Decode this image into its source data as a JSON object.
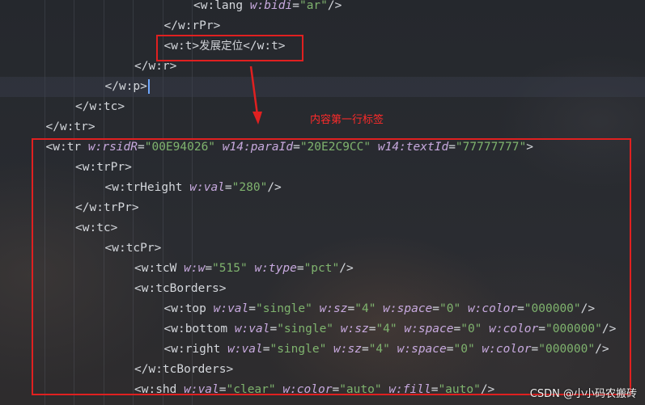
{
  "colors": {
    "background": "#23262b",
    "tag": "#d4d7dc",
    "attribute_name": "#c7a9de",
    "attribute_value": "#7fb36e",
    "annotation_red": "#e02020",
    "caret": "#6fa8ff"
  },
  "code_lines": [
    {
      "indent": 6,
      "tokens": [
        {
          "k": "tag",
          "t": "<w:lang "
        },
        {
          "k": "an",
          "t": "w:bidi"
        },
        {
          "k": "tag",
          "t": "="
        },
        {
          "k": "av",
          "t": "\"ar\""
        },
        {
          "k": "tag",
          "t": "/>"
        }
      ]
    },
    {
      "indent": 5,
      "tokens": [
        {
          "k": "tag",
          "t": "</w:rPr>"
        }
      ]
    },
    {
      "indent": 5,
      "tokens": [
        {
          "k": "tag",
          "t": "<w:t>"
        },
        {
          "k": "tx",
          "t": "发展定位"
        },
        {
          "k": "tag",
          "t": "</w:t>"
        }
      ]
    },
    {
      "indent": 4,
      "tokens": [
        {
          "k": "tag",
          "t": "</w:r>"
        }
      ]
    },
    {
      "indent": 3,
      "current": true,
      "tokens": [
        {
          "k": "tag",
          "t": "</w:p>"
        }
      ]
    },
    {
      "indent": 2,
      "tokens": [
        {
          "k": "tag",
          "t": "</w:tc>"
        }
      ]
    },
    {
      "indent": 1,
      "tokens": [
        {
          "k": "tag",
          "t": "</w:tr>"
        }
      ]
    },
    {
      "indent": 1,
      "tokens": [
        {
          "k": "tag",
          "t": "<w:tr "
        },
        {
          "k": "an",
          "t": "w:rsidR"
        },
        {
          "k": "tag",
          "t": "="
        },
        {
          "k": "av",
          "t": "\"00E94026\""
        },
        {
          "k": "tag",
          "t": " "
        },
        {
          "k": "an",
          "t": "w14:paraId"
        },
        {
          "k": "tag",
          "t": "="
        },
        {
          "k": "av",
          "t": "\"20E2C9CC\""
        },
        {
          "k": "tag",
          "t": " "
        },
        {
          "k": "an",
          "t": "w14:textId"
        },
        {
          "k": "tag",
          "t": "="
        },
        {
          "k": "av",
          "t": "\"77777777\""
        },
        {
          "k": "tag",
          "t": ">"
        }
      ]
    },
    {
      "indent": 2,
      "tokens": [
        {
          "k": "tag",
          "t": "<w:trPr>"
        }
      ]
    },
    {
      "indent": 3,
      "tokens": [
        {
          "k": "tag",
          "t": "<w:trHeight "
        },
        {
          "k": "an",
          "t": "w:val"
        },
        {
          "k": "tag",
          "t": "="
        },
        {
          "k": "av",
          "t": "\"280\""
        },
        {
          "k": "tag",
          "t": "/>"
        }
      ]
    },
    {
      "indent": 2,
      "tokens": [
        {
          "k": "tag",
          "t": "</w:trPr>"
        }
      ]
    },
    {
      "indent": 2,
      "tokens": [
        {
          "k": "tag",
          "t": "<w:tc>"
        }
      ]
    },
    {
      "indent": 3,
      "tokens": [
        {
          "k": "tag",
          "t": "<w:tcPr>"
        }
      ]
    },
    {
      "indent": 4,
      "tokens": [
        {
          "k": "tag",
          "t": "<w:tcW "
        },
        {
          "k": "an",
          "t": "w:w"
        },
        {
          "k": "tag",
          "t": "="
        },
        {
          "k": "av",
          "t": "\"515\""
        },
        {
          "k": "tag",
          "t": " "
        },
        {
          "k": "an",
          "t": "w:type"
        },
        {
          "k": "tag",
          "t": "="
        },
        {
          "k": "av",
          "t": "\"pct\""
        },
        {
          "k": "tag",
          "t": "/>"
        }
      ]
    },
    {
      "indent": 4,
      "tokens": [
        {
          "k": "tag",
          "t": "<w:tcBorders>"
        }
      ]
    },
    {
      "indent": 5,
      "tokens": [
        {
          "k": "tag",
          "t": "<w:top "
        },
        {
          "k": "an",
          "t": "w:val"
        },
        {
          "k": "tag",
          "t": "="
        },
        {
          "k": "av",
          "t": "\"single\""
        },
        {
          "k": "tag",
          "t": " "
        },
        {
          "k": "an",
          "t": "w:sz"
        },
        {
          "k": "tag",
          "t": "="
        },
        {
          "k": "av",
          "t": "\"4\""
        },
        {
          "k": "tag",
          "t": " "
        },
        {
          "k": "an",
          "t": "w:space"
        },
        {
          "k": "tag",
          "t": "="
        },
        {
          "k": "av",
          "t": "\"0\""
        },
        {
          "k": "tag",
          "t": " "
        },
        {
          "k": "an",
          "t": "w:color"
        },
        {
          "k": "tag",
          "t": "="
        },
        {
          "k": "av",
          "t": "\"000000\""
        },
        {
          "k": "tag",
          "t": "/>"
        }
      ]
    },
    {
      "indent": 5,
      "tokens": [
        {
          "k": "tag",
          "t": "<w:bottom "
        },
        {
          "k": "an",
          "t": "w:val"
        },
        {
          "k": "tag",
          "t": "="
        },
        {
          "k": "av",
          "t": "\"single\""
        },
        {
          "k": "tag",
          "t": " "
        },
        {
          "k": "an",
          "t": "w:sz"
        },
        {
          "k": "tag",
          "t": "="
        },
        {
          "k": "av",
          "t": "\"4\""
        },
        {
          "k": "tag",
          "t": " "
        },
        {
          "k": "an",
          "t": "w:space"
        },
        {
          "k": "tag",
          "t": "="
        },
        {
          "k": "av",
          "t": "\"0\""
        },
        {
          "k": "tag",
          "t": " "
        },
        {
          "k": "an",
          "t": "w:color"
        },
        {
          "k": "tag",
          "t": "="
        },
        {
          "k": "av",
          "t": "\"000000\""
        },
        {
          "k": "tag",
          "t": "/>"
        }
      ]
    },
    {
      "indent": 5,
      "tokens": [
        {
          "k": "tag",
          "t": "<w:right "
        },
        {
          "k": "an",
          "t": "w:val"
        },
        {
          "k": "tag",
          "t": "="
        },
        {
          "k": "av",
          "t": "\"single\""
        },
        {
          "k": "tag",
          "t": " "
        },
        {
          "k": "an",
          "t": "w:sz"
        },
        {
          "k": "tag",
          "t": "="
        },
        {
          "k": "av",
          "t": "\"4\""
        },
        {
          "k": "tag",
          "t": " "
        },
        {
          "k": "an",
          "t": "w:space"
        },
        {
          "k": "tag",
          "t": "="
        },
        {
          "k": "av",
          "t": "\"0\""
        },
        {
          "k": "tag",
          "t": " "
        },
        {
          "k": "an",
          "t": "w:color"
        },
        {
          "k": "tag",
          "t": "="
        },
        {
          "k": "av",
          "t": "\"000000\""
        },
        {
          "k": "tag",
          "t": "/>"
        }
      ]
    },
    {
      "indent": 4,
      "tokens": [
        {
          "k": "tag",
          "t": "</w:tcBorders>"
        }
      ]
    },
    {
      "indent": 4,
      "tokens": [
        {
          "k": "tag",
          "t": "<w:shd "
        },
        {
          "k": "an",
          "t": "w:val"
        },
        {
          "k": "tag",
          "t": "="
        },
        {
          "k": "av",
          "t": "\"clear\""
        },
        {
          "k": "tag",
          "t": " "
        },
        {
          "k": "an",
          "t": "w:color"
        },
        {
          "k": "tag",
          "t": "="
        },
        {
          "k": "av",
          "t": "\"auto\""
        },
        {
          "k": "tag",
          "t": " "
        },
        {
          "k": "an",
          "t": "w:fill"
        },
        {
          "k": "tag",
          "t": "="
        },
        {
          "k": "av",
          "t": "\"auto\""
        },
        {
          "k": "tag",
          "t": "/>"
        }
      ]
    }
  ],
  "annotation": {
    "label": "内容第一行标签"
  },
  "watermark": "CSDN @小小码农搬砖"
}
